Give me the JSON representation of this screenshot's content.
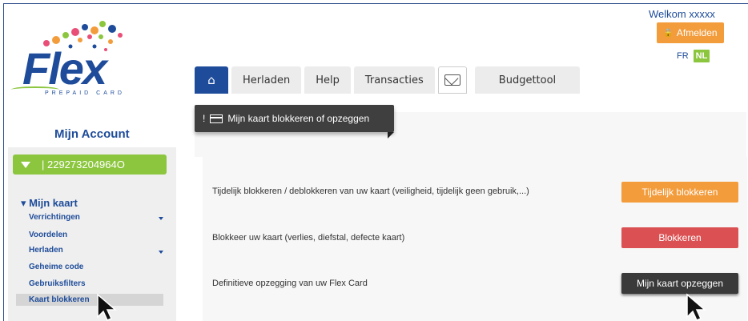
{
  "brand": {
    "logo_word": "Flex",
    "logo_sub": "PREPAID CARD"
  },
  "header": {
    "welcome": "Welkom xxxxx",
    "logout_label": "Afmelden",
    "lang_fr": "FR",
    "lang_nl": "NL"
  },
  "tabs": [
    {
      "label": ""
    },
    {
      "label": "Herladen"
    },
    {
      "label": "Help"
    },
    {
      "label": "Transacties"
    },
    {
      "label": ""
    },
    {
      "label": "Budgettool"
    }
  ],
  "section": {
    "title": "Mijn kaart blokkeren of opzeggen"
  },
  "rows": [
    {
      "text": "Tijdelijk blokkeren / deblokkeren van uw kaart (veiligheid, tijdelijk geen gebruik,...)",
      "button": "Tijdelijk blokkeren"
    },
    {
      "text": "Blokkeer uw kaart (verlies, diefstal, defecte kaart)",
      "button": "Blokkeren"
    },
    {
      "text": "Definitieve opzegging van uw Flex Card",
      "button": "Mijn kaart opzeggen"
    }
  ],
  "sidebar": {
    "title": "Mijn Account",
    "card_number": "| 229273204964O",
    "menu_head": "▾ Mijn kaart",
    "items": [
      {
        "label": "Verrichtingen"
      },
      {
        "label": "Voordelen"
      },
      {
        "label": "Herladen"
      },
      {
        "label": "Geheime code"
      },
      {
        "label": "Gebruiksfilters"
      },
      {
        "label": "Kaart blokkeren"
      }
    ]
  },
  "colors": {
    "brand_blue": "#1e4c9a",
    "green": "#8cc63f",
    "orange": "#f39c3c",
    "red": "#db5153",
    "dark": "#3a3a3a"
  }
}
